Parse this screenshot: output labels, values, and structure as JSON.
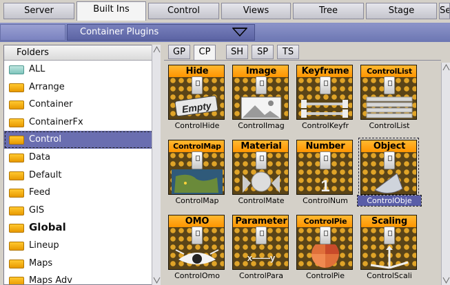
{
  "top_tabs": [
    {
      "label": "Server",
      "active": false
    },
    {
      "label": "Built Ins",
      "active": true
    },
    {
      "label": "Control",
      "active": false
    },
    {
      "label": "Views",
      "active": false
    },
    {
      "label": "Tree",
      "active": false
    },
    {
      "label": "Stage",
      "active": false
    },
    {
      "label": "Se",
      "active": false
    }
  ],
  "category": {
    "label": "Container Plugins",
    "icon": "chevron-down-icon"
  },
  "folders": {
    "header": "Folders",
    "items": [
      {
        "label": "ALL",
        "icon": "folder-icon",
        "color": "#9fd6cf",
        "selected": false,
        "bold": false
      },
      {
        "label": "Arrange",
        "icon": "folder-icon",
        "selected": false,
        "bold": false
      },
      {
        "label": "Container",
        "icon": "folder-icon",
        "selected": false,
        "bold": false
      },
      {
        "label": "ContainerFx",
        "icon": "folder-icon",
        "selected": false,
        "bold": false
      },
      {
        "label": "Control",
        "icon": "folder-icon",
        "selected": true,
        "bold": false
      },
      {
        "label": "Data",
        "icon": "folder-icon",
        "selected": false,
        "bold": false
      },
      {
        "label": "Default",
        "icon": "folder-icon",
        "selected": false,
        "bold": false
      },
      {
        "label": "Feed",
        "icon": "folder-icon",
        "selected": false,
        "bold": false
      },
      {
        "label": "GIS",
        "icon": "folder-icon",
        "selected": false,
        "bold": false
      },
      {
        "label": "Global",
        "icon": "folder-icon",
        "selected": false,
        "bold": true
      },
      {
        "label": "Lineup",
        "icon": "folder-icon",
        "selected": false,
        "bold": false
      },
      {
        "label": "Maps",
        "icon": "folder-icon",
        "selected": false,
        "bold": false
      },
      {
        "label": "Maps Adv",
        "icon": "folder-icon",
        "selected": false,
        "bold": false
      }
    ]
  },
  "sub_tabs": [
    {
      "label": "GP",
      "active": false
    },
    {
      "label": "CP",
      "active": true
    },
    {
      "label": "SH",
      "active": false
    },
    {
      "label": "SP",
      "active": false
    },
    {
      "label": "TS",
      "active": false
    }
  ],
  "plugins": [
    {
      "title": "Hide",
      "caption": "ControlHide",
      "art": "empty-sign-icon",
      "selected": false
    },
    {
      "title": "Image",
      "caption": "ControlImag",
      "art": "image-icon",
      "selected": false
    },
    {
      "title": "Keyframe",
      "caption": "ControlKeyfr",
      "art": "keyframe-icon",
      "selected": false
    },
    {
      "title": "ControlList",
      "caption": "ControlList",
      "art": "list-icon",
      "selected": false
    },
    {
      "title": "ControlMap",
      "caption": "ControlMap",
      "art": "map-icon",
      "selected": false
    },
    {
      "title": "Material",
      "caption": "ControlMate",
      "art": "material-sphere-icon",
      "selected": false
    },
    {
      "title": "Number",
      "caption": "ControlNum",
      "art": "number-icon",
      "selected": false
    },
    {
      "title": "Object",
      "caption": "ControlObje",
      "art": "cone-object-icon",
      "selected": true
    },
    {
      "title": "OMO",
      "caption": "ControlOmo",
      "art": "eye-icon",
      "selected": false
    },
    {
      "title": "Parameter",
      "caption": "ControlPara",
      "art": "xy-parameter-icon",
      "selected": false
    },
    {
      "title": "ControlPie",
      "caption": "ControlPie",
      "art": "pie-icon",
      "selected": false
    },
    {
      "title": "Scaling",
      "caption": "ControlScali",
      "art": "scaling-axes-icon",
      "selected": false
    }
  ],
  "empty_sign_text": "Empty",
  "number_glyph": "1",
  "parameter_glyph": "x——y",
  "colors": {
    "accent": "#ff9f10",
    "selection": "#6a6eb0",
    "header_bar": "#7880bc"
  }
}
